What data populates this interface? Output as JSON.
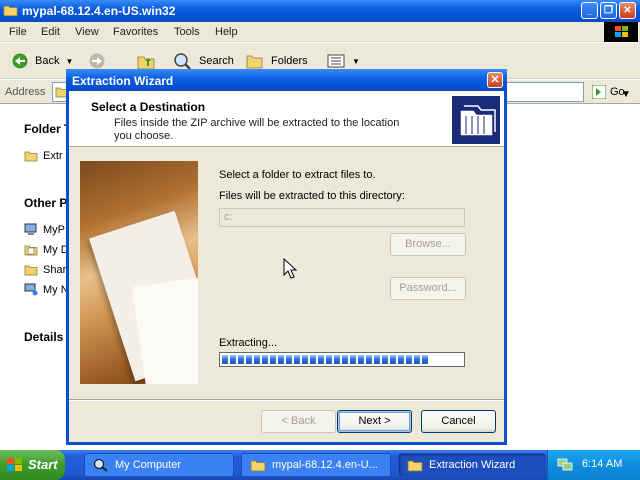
{
  "explorer": {
    "title": "mypal-68.12.4.en-US.win32",
    "menu": [
      "File",
      "Edit",
      "View",
      "Favorites",
      "Tools",
      "Help"
    ],
    "toolbar": {
      "back_label": "Back",
      "search_label": "Search",
      "folders_label": "Folders"
    },
    "address": {
      "label": "Address",
      "value": "",
      "go_label": "Go"
    },
    "left_pane": {
      "folder_tasks_heading": "Folder T",
      "folder_tasks": [
        "Extr"
      ],
      "other_places_heading": "Other P",
      "other_places": [
        "MyP",
        "My D",
        "Shar",
        "My N"
      ],
      "details_heading": "Details"
    }
  },
  "wizard": {
    "title": "Extraction Wizard",
    "header_title": "Select a Destination",
    "header_subtitle": "Files inside the ZIP archive will be extracted to the location you choose.",
    "instruction": "Select a folder to extract files to.",
    "directory_label": "Files will be extracted to this directory:",
    "directory_value": "c:",
    "browse_label": "Browse...",
    "password_label": "Password...",
    "status": "Extracting...",
    "progress": 0.87,
    "back_label": "< Back",
    "next_label": "Next >",
    "cancel_label": "Cancel"
  },
  "taskbar": {
    "start_label": "Start",
    "tasks": [
      "My Computer",
      "mypal-68.12.4.en-U...",
      "Extraction Wizard"
    ],
    "clock": "6:14 AM"
  },
  "colors": {
    "titlebar": "#0a5ee0",
    "window_bg": "#ece9d8",
    "taskbar": "#245edb",
    "start_green": "#3c9a2a",
    "progress_blue": "#2b6fd6"
  }
}
